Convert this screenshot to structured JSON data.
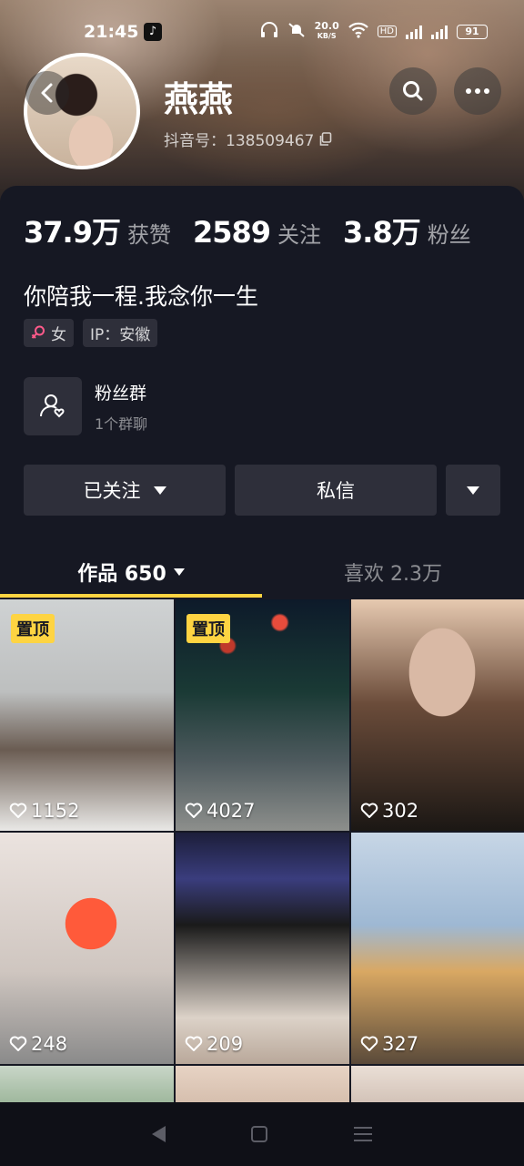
{
  "status_bar": {
    "time": "21:45",
    "speed_value": "20.0",
    "speed_unit": "KB/S",
    "hd": "HD",
    "battery": "91",
    "net1": "4G",
    "net2": "4G"
  },
  "profile": {
    "name": "燕燕",
    "douyin_id": "抖音号：138509467",
    "bio": "你陪我一程.我念你一生",
    "gender_tag": "女",
    "ip_tag": "IP：安徽"
  },
  "stats": {
    "likes_num": "37.9万",
    "likes_label": "获赞",
    "following_num": "2589",
    "following_label": "关注",
    "fans_num": "3.8万",
    "fans_label": "粉丝"
  },
  "fan_group": {
    "title": "粉丝群",
    "subtitle": "1个群聊"
  },
  "actions": {
    "followed": "已关注",
    "message": "私信"
  },
  "tabs": {
    "works": "作品 650",
    "likes": "喜欢 2.3万"
  },
  "videos": [
    {
      "pinned": "置顶",
      "likes": "1152"
    },
    {
      "pinned": "置顶",
      "likes": "4027"
    },
    {
      "likes": "302"
    },
    {
      "likes": "248"
    },
    {
      "likes": "209"
    },
    {
      "likes": "327"
    }
  ],
  "colors": {
    "background": "#161823",
    "accent_yellow": "#fed442",
    "button_bg": "#2e2f3a"
  }
}
